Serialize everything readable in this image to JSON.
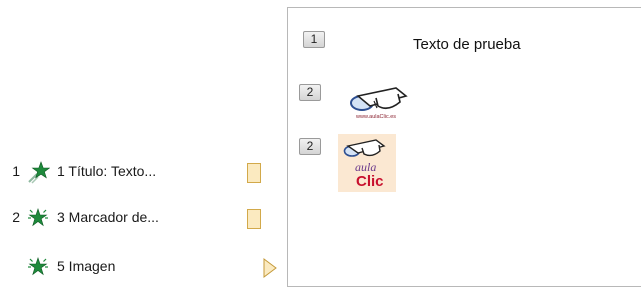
{
  "animation_pane": {
    "items": [
      {
        "order": "1",
        "label": "1 Título: Texto...",
        "effect_icon": "star-fly-in-effect-icon"
      },
      {
        "order": "2",
        "label": "3 Marcador de...",
        "effect_icon": "star-entrance-effect-icon"
      },
      {
        "order": "",
        "label": "5 Imagen",
        "effect_icon": "star-entrance-effect-icon"
      }
    ],
    "colors": {
      "star": "#1e8a3c",
      "timeline_bar": "#fbeac0"
    }
  },
  "slide": {
    "tags": [
      "1",
      "2",
      "2"
    ],
    "title_text": "Texto de prueba",
    "logos": [
      {
        "name": "aulaclic-logo-wide",
        "tagline": "www.aulaClic.es"
      },
      {
        "name": "aulaclic-logo-square",
        "text_top": "aula",
        "text_bottom": "Clic",
        "bg": "#fbe8d2"
      }
    ]
  }
}
